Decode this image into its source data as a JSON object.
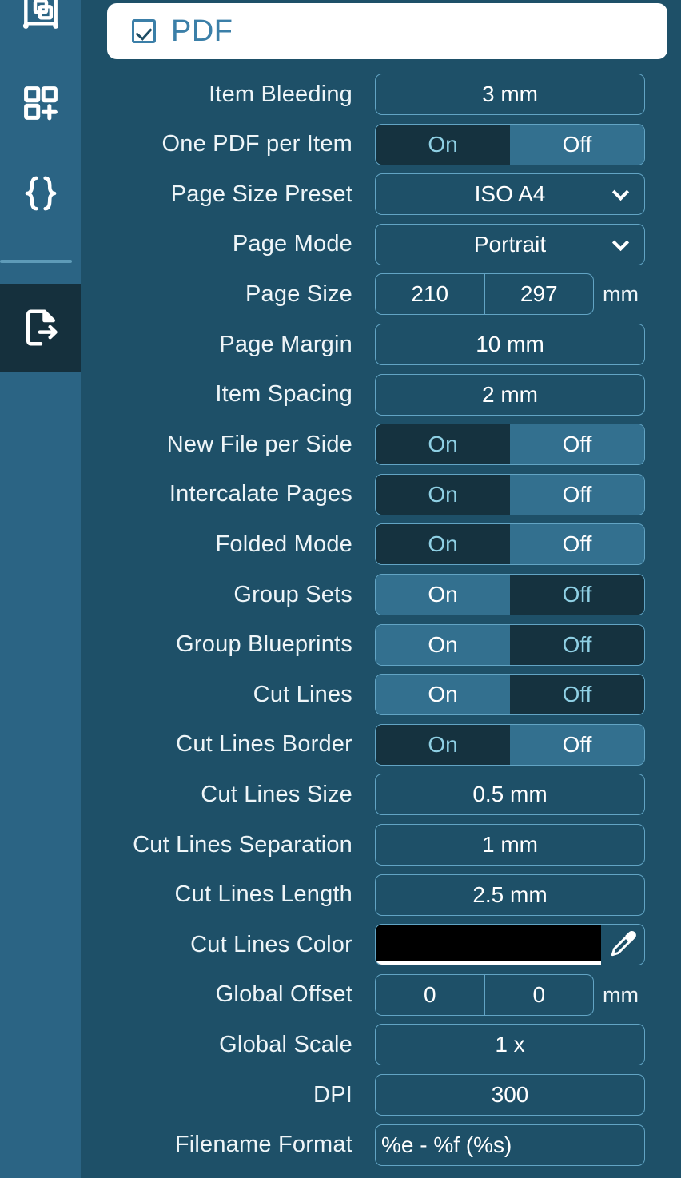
{
  "sidebar": {
    "items": [
      {
        "icon": "board-layout-icon",
        "name": "sidebar-item-board",
        "active": false
      },
      {
        "icon": "add-grid-icon",
        "name": "sidebar-item-add-grid",
        "active": false
      },
      {
        "icon": "braces-icon",
        "name": "sidebar-item-script",
        "active": false
      },
      {
        "icon": "file-export-icon",
        "name": "sidebar-item-export",
        "active": true
      }
    ]
  },
  "header": {
    "checkbox_checked": true,
    "title": "PDF"
  },
  "colors": {
    "panel_bg": "#1e5068",
    "sidebar_bg": "#2b6484",
    "sidebar_active_bg": "#15303d",
    "accent_border": "#62a4c4",
    "segment_selected": "#33708f",
    "segment_unselected": "#15323f",
    "header_card_bg": "#ffffff",
    "header_accent": "#3b7fa8",
    "cut_lines_color_swatch": "#000000"
  },
  "toggle": {
    "on_label": "On",
    "off_label": "Off"
  },
  "rows": [
    {
      "label": "Item Bleeding",
      "type": "value",
      "value": "3 mm"
    },
    {
      "label": "One PDF per Item",
      "type": "toggle",
      "value": "Off"
    },
    {
      "label": "Page Size Preset",
      "type": "dropdown",
      "value": "ISO A4"
    },
    {
      "label": "Page Mode",
      "type": "dropdown",
      "value": "Portrait"
    },
    {
      "label": "Page Size",
      "type": "dual",
      "value1": "210",
      "value2": "297",
      "unit": "mm"
    },
    {
      "label": "Page Margin",
      "type": "value",
      "value": "10 mm"
    },
    {
      "label": "Item Spacing",
      "type": "value",
      "value": "2 mm"
    },
    {
      "label": "New File per Side",
      "type": "toggle",
      "value": "Off"
    },
    {
      "label": "Intercalate Pages",
      "type": "toggle",
      "value": "Off"
    },
    {
      "label": "Folded Mode",
      "type": "toggle",
      "value": "Off"
    },
    {
      "label": "Group Sets",
      "type": "toggle",
      "value": "On"
    },
    {
      "label": "Group Blueprints",
      "type": "toggle",
      "value": "On"
    },
    {
      "label": "Cut Lines",
      "type": "toggle",
      "value": "On"
    },
    {
      "label": "Cut Lines Border",
      "type": "toggle",
      "value": "Off"
    },
    {
      "label": "Cut Lines Size",
      "type": "value",
      "value": "0.5 mm"
    },
    {
      "label": "Cut Lines Separation",
      "type": "value",
      "value": "1 mm"
    },
    {
      "label": "Cut Lines Length",
      "type": "value",
      "value": "2.5 mm"
    },
    {
      "label": "Cut Lines Color",
      "type": "color",
      "value": "#000000"
    },
    {
      "label": "Global Offset",
      "type": "dual",
      "value1": "0",
      "value2": "0",
      "unit": "mm"
    },
    {
      "label": "Global Scale",
      "type": "value",
      "value": "1 x"
    },
    {
      "label": "DPI",
      "type": "value",
      "value": "300"
    },
    {
      "label": "Filename Format",
      "type": "text",
      "value": "%e - %f (%s)"
    }
  ]
}
